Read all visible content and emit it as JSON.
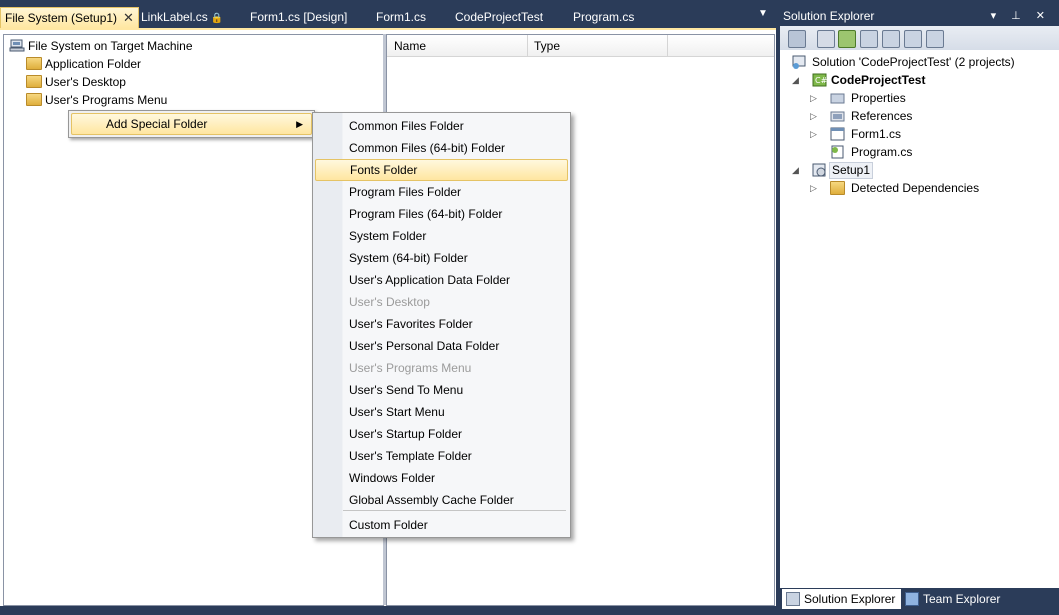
{
  "tabs": [
    {
      "label": "File System (Setup1)",
      "close": "✕",
      "active": true
    },
    {
      "label": "LinkLabel.cs",
      "lock": "🔒",
      "active": false
    },
    {
      "label": "Form1.cs [Design]",
      "active": false
    },
    {
      "label": "Form1.cs",
      "active": false
    },
    {
      "label": "CodeProjectTest",
      "active": false
    },
    {
      "label": "Program.cs",
      "active": false
    }
  ],
  "tab_dropdown": "▼",
  "fs_tree": {
    "root": "File System on Target Machine",
    "items": [
      "Application Folder",
      "User's Desktop",
      "User's Programs Menu"
    ]
  },
  "list_columns": [
    "Name",
    "Type"
  ],
  "context_menu": {
    "item": "Add Special Folder",
    "arrow": "▶"
  },
  "special_folders": [
    {
      "label": "Common Files Folder",
      "disabled": false
    },
    {
      "label": "Common Files (64-bit) Folder",
      "disabled": false
    },
    {
      "label": "Fonts Folder",
      "disabled": false,
      "hover": true
    },
    {
      "label": "Program Files Folder",
      "disabled": false
    },
    {
      "label": "Program Files (64-bit) Folder",
      "disabled": false
    },
    {
      "label": "System Folder",
      "disabled": false
    },
    {
      "label": "System (64-bit) Folder",
      "disabled": false
    },
    {
      "label": "User's Application Data Folder",
      "disabled": false
    },
    {
      "label": "User's Desktop",
      "disabled": true
    },
    {
      "label": "User's Favorites Folder",
      "disabled": false
    },
    {
      "label": "User's Personal Data Folder",
      "disabled": false
    },
    {
      "label": "User's Programs Menu",
      "disabled": true
    },
    {
      "label": "User's Send To Menu",
      "disabled": false
    },
    {
      "label": "User's Start Menu",
      "disabled": false
    },
    {
      "label": "User's Startup Folder",
      "disabled": false
    },
    {
      "label": "User's Template Folder",
      "disabled": false
    },
    {
      "label": "Windows Folder",
      "disabled": false
    },
    {
      "label": "Global Assembly Cache Folder",
      "disabled": false
    }
  ],
  "custom_folder": "Custom Folder",
  "solution_explorer": {
    "title": "Solution Explorer",
    "header_buttons": "▾ ⊥ ✕",
    "solution": "Solution 'CodeProjectTest' (2 projects)",
    "project": "CodeProjectTest",
    "project_items": [
      "Properties",
      "References",
      "Form1.cs",
      "Program.cs"
    ],
    "setup_project": "Setup1",
    "setup_items": [
      "Detected Dependencies"
    ],
    "expand_open": "◢",
    "expand_closed": "▷"
  },
  "bottom_tabs": [
    "Solution Explorer",
    "Team Explorer"
  ],
  "colors": {
    "chrome": "#2b3c59",
    "active_tab": "#ffe7a2",
    "menu_hover": "#ffe6a0",
    "disabled_text": "#9b9b9b"
  }
}
